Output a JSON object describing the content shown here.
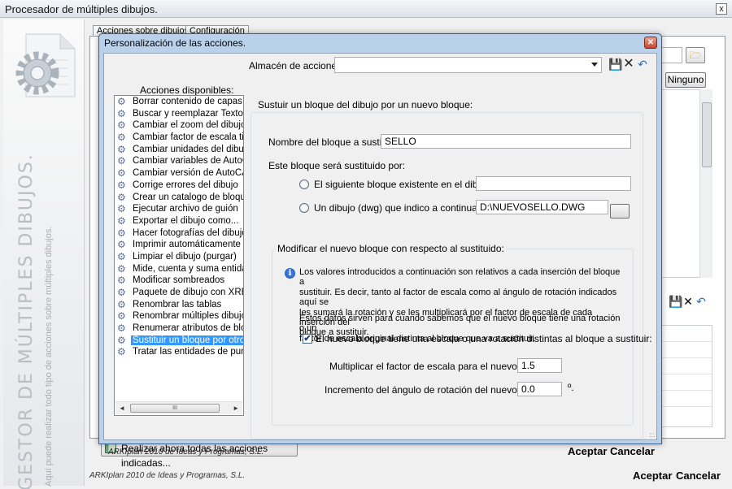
{
  "outer": {
    "title": "Procesador de múltiples dibujos.",
    "close_label": "x",
    "tabs": [
      "Acciones sobre dibujos",
      "Configuración"
    ],
    "vertical_title": "GESTOR DE MÚLTIPLES DIBUJOS.",
    "vertical_subtitle": "Aquí puede realizar todo tipo de acciones sobre múltiples dibujos.",
    "ninguno_label": "Ninguno",
    "realizar_label": "Realizar ahora todas las acciones indicadas...",
    "footer": "ARKIplan 2010 de Ideas y Programas, S.L.",
    "ok_label": "Aceptar",
    "cancel_label": "Cancelar"
  },
  "dialog": {
    "title": "Personalización de las acciones.",
    "almacen_label": "Almacén de acciones:",
    "almacen_value": "",
    "acciones_label": "Acciones disponibles:",
    "actions": [
      "Borrar contenido de capas",
      "Buscar y reemplazar Textos",
      "Cambiar el zoom del dibujo",
      "Cambiar factor de escala tipolír",
      "Cambiar unidades del dibujo",
      "Cambiar variables de AutoCAD",
      "Cambiar versión de AutoCAD",
      "Corrige errores del dibujo",
      "Crear un catalogo de bloques",
      "Ejecutar archivo de guión",
      "Exportar el dibujo como...",
      "Hacer fotografías del dibujo",
      "Imprimir automáticamente",
      "Limpiar el dibujo (purgar)",
      "Mide, cuenta y suma entidades",
      "Modificar sombreados",
      "Paquete de dibujo con XREF",
      "Renombrar las tablas",
      "Renombrar múltiples dibujos",
      "Renumerar atributos de bloque",
      "Sustituir un bloque por otro",
      "Tratar las entidades de punto"
    ],
    "selected_action": "Sustituir un bloque por otro",
    "scroll_thumb_label": "III",
    "group_title": "Sustuir un bloque del dibujo por un nuevo bloque:",
    "nombre_label": "Nombre del bloque a sustituir:",
    "nombre_value": "SELLO",
    "sustituido_label": "Este bloque será sustituido por:",
    "radio_existente_label": "El siguiente bloque existente en el dibujo:",
    "existente_value": "",
    "radio_dwg_label": "Un dibujo (dwg) que indico a continuación:",
    "dwg_value": "D:\\NUEVOSELLO.DWG",
    "sub_group_title": "Modificar el nuevo bloque con respecto al sustituido:",
    "info_p1": [
      "Los valores introducidos a continuación son relativos a cada inserción del bloque a",
      "sustituir. Es decir, tanto al factor de escala como al ángulo de rotación indicados aquí se",
      "les sumará la rotación y se les multiplicará por el factor de escala de cada inserción del",
      "bloque a sustituir."
    ],
    "info_p2": [
      "Estos datos sirven para cuando sabemos que el nuevo bloque tiene una rotación o un",
      "factor de escala original distinta al bloque que va a sustituir."
    ],
    "checkbox_label": "El nuevo bloque tiene una escala o una rotación distintas al bloque a sustituir:",
    "checkbox_checked": true,
    "escala_label": "Multiplicar el factor de escala para el nuevo bloque:",
    "escala_value": "1.5",
    "angulo_label": "Incremento del ángulo de rotación del nuevo bloque:",
    "angulo_value": "0.0",
    "angulo_unit": "º.",
    "footer": "ARKIplan 2010 de Ideas y Programas, S.L.",
    "ok_label": "Aceptar",
    "cancel_label": "Cancelar"
  },
  "icons": {
    "save": "save-icon",
    "delete": "delete-icon",
    "undo": "undo-icon",
    "action_item": "gear-icon",
    "info": "info-icon",
    "folder": "folder-icon"
  },
  "colors": {
    "selection": "#3399ff",
    "dialog_frame": "#b9d1ea",
    "accent_blue": "#1e4fa0"
  }
}
